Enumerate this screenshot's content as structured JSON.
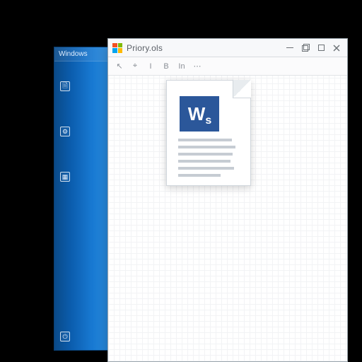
{
  "side_panel": {
    "title": "Windows",
    "items": [
      {
        "icon": "file-icon",
        "label": ""
      },
      {
        "icon": "settings-icon",
        "label": ""
      },
      {
        "icon": "apps-icon",
        "label": ""
      }
    ],
    "footer": {
      "icon": "power-icon",
      "label": ""
    }
  },
  "window": {
    "title": "Priory.ols",
    "controls": {
      "minimize": "Minimize",
      "restore": "Restore",
      "maximize": "Maximize",
      "close": "Close"
    },
    "toolbar": {
      "items": [
        {
          "name": "cursor-tool",
          "glyph": "↖"
        },
        {
          "name": "select-tool",
          "glyph": "⌖"
        },
        {
          "name": "text-tool",
          "glyph": "I"
        },
        {
          "name": "bold-tool",
          "glyph": "B"
        },
        {
          "name": "insert-tool",
          "glyph": "In"
        },
        {
          "name": "more-tool",
          "glyph": "⋯"
        }
      ]
    },
    "doc_icon": {
      "badge_main": "W",
      "badge_sub": "s"
    }
  },
  "colors": {
    "word_blue": "#2b579a",
    "panel_blue": "#1879d2"
  }
}
